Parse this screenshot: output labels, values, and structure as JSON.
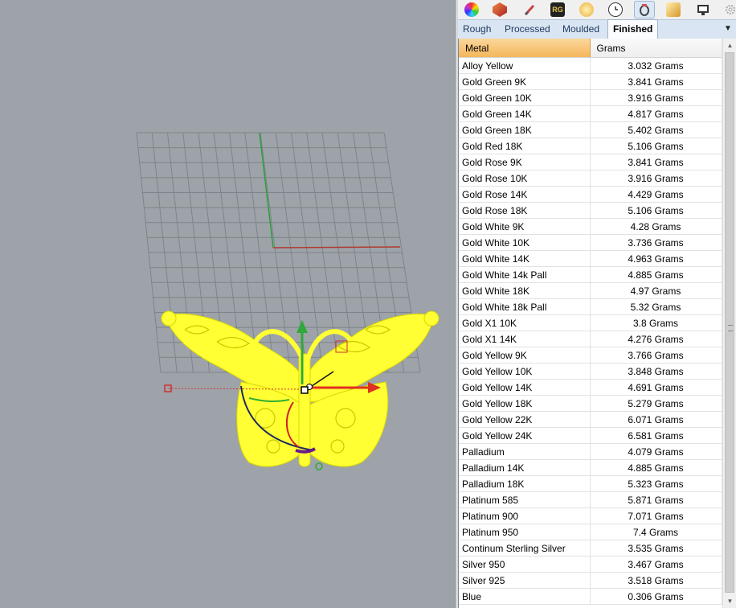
{
  "toolbar": {
    "icons": [
      "color-wheel-icon",
      "cube-material-icon",
      "brush-icon",
      "rg-icon",
      "gem-icon",
      "clock-icon",
      "ring-icon",
      "gold-gem-icon",
      "monitor-icon",
      "settings-icon"
    ],
    "rg_label": "RG"
  },
  "tabs": [
    {
      "label": "Rough",
      "active": false
    },
    {
      "label": "Processed",
      "active": false
    },
    {
      "label": "Moulded",
      "active": false
    },
    {
      "label": "Finished",
      "active": true
    }
  ],
  "table": {
    "headers": [
      "Metal",
      "Grams"
    ],
    "rows": [
      [
        "Alloy Yellow",
        "3.032 Grams"
      ],
      [
        "Gold Green 9K",
        "3.841 Grams"
      ],
      [
        "Gold Green 10K",
        "3.916 Grams"
      ],
      [
        "Gold Green 14K",
        "4.817 Grams"
      ],
      [
        "Gold Green 18K",
        "5.402 Grams"
      ],
      [
        "Gold Red 18K",
        "5.106 Grams"
      ],
      [
        "Gold Rose 9K",
        "3.841 Grams"
      ],
      [
        "Gold Rose 10K",
        "3.916 Grams"
      ],
      [
        "Gold Rose 14K",
        "4.429 Grams"
      ],
      [
        "Gold Rose 18K",
        "5.106 Grams"
      ],
      [
        "Gold White 9K",
        "4.28 Grams"
      ],
      [
        "Gold White 10K",
        "3.736 Grams"
      ],
      [
        "Gold White 14K",
        "4.963 Grams"
      ],
      [
        "Gold White 14k Pall",
        "4.885 Grams"
      ],
      [
        "Gold White 18K",
        "4.97 Grams"
      ],
      [
        "Gold White 18k Pall",
        "5.32 Grams"
      ],
      [
        "Gold X1 10K",
        "3.8 Grams"
      ],
      [
        "Gold X1 14K",
        "4.276 Grams"
      ],
      [
        "Gold Yellow 9K",
        "3.766 Grams"
      ],
      [
        "Gold Yellow 10K",
        "3.848 Grams"
      ],
      [
        "Gold Yellow 14K",
        "4.691 Grams"
      ],
      [
        "Gold Yellow 18K",
        "5.279 Grams"
      ],
      [
        "Gold Yellow 22K",
        "6.071 Grams"
      ],
      [
        "Gold Yellow 24K",
        "6.581 Grams"
      ],
      [
        "Palladium",
        "4.079 Grams"
      ],
      [
        "Palladium 14K",
        "4.885 Grams"
      ],
      [
        "Palladium 18K",
        "5.323 Grams"
      ],
      [
        "Platinum 585",
        "5.871 Grams"
      ],
      [
        "Platinum 900",
        "7.071 Grams"
      ],
      [
        "Platinum 950",
        "7.4 Grams"
      ],
      [
        "Continum Sterling Silver",
        "3.535 Grams"
      ],
      [
        "Silver 950",
        "3.467 Grams"
      ],
      [
        "Silver 925",
        "3.518 Grams"
      ],
      [
        "Blue",
        "0.306 Grams"
      ]
    ]
  },
  "colors": {
    "selection": "#ffff33",
    "x_axis": "#c0392b",
    "y_axis": "#2e9e3a",
    "header_accent": "#f5b75b"
  }
}
